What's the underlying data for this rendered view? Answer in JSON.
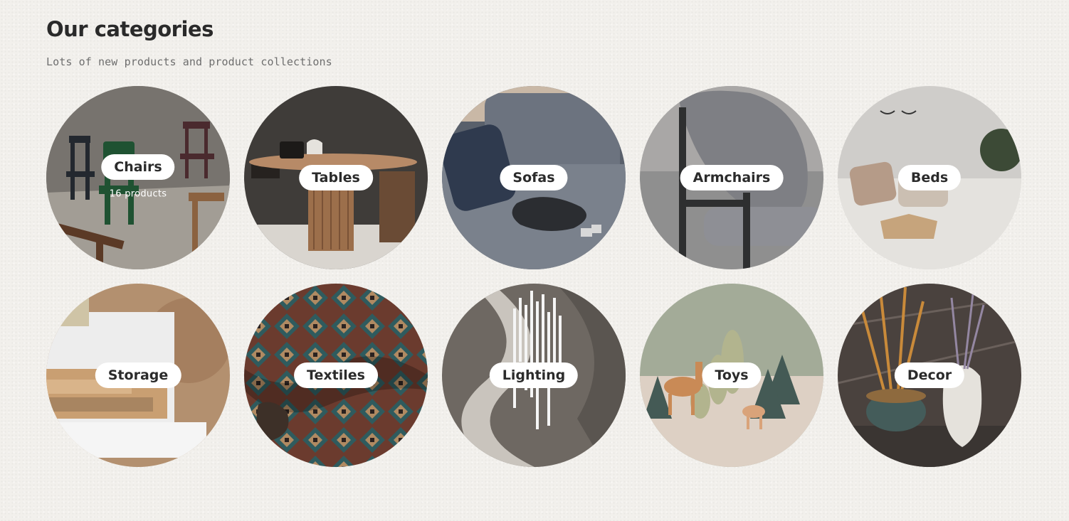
{
  "section": {
    "title": "Our categories",
    "subtitle": "Lots of new products and product collections"
  },
  "categories": [
    {
      "name": "Chairs",
      "count_label": "16 products",
      "image": "chairs-photo"
    },
    {
      "name": "Tables",
      "image": "tables-photo"
    },
    {
      "name": "Sofas",
      "image": "sofas-photo"
    },
    {
      "name": "Armchairs",
      "image": "armchairs-photo"
    },
    {
      "name": "Beds",
      "image": "beds-photo"
    },
    {
      "name": "Storage",
      "image": "storage-photo"
    },
    {
      "name": "Textiles",
      "image": "textiles-photo"
    },
    {
      "name": "Lighting",
      "image": "lighting-photo"
    },
    {
      "name": "Toys",
      "image": "toys-photo"
    },
    {
      "name": "Decor",
      "image": "decor-photo"
    }
  ]
}
